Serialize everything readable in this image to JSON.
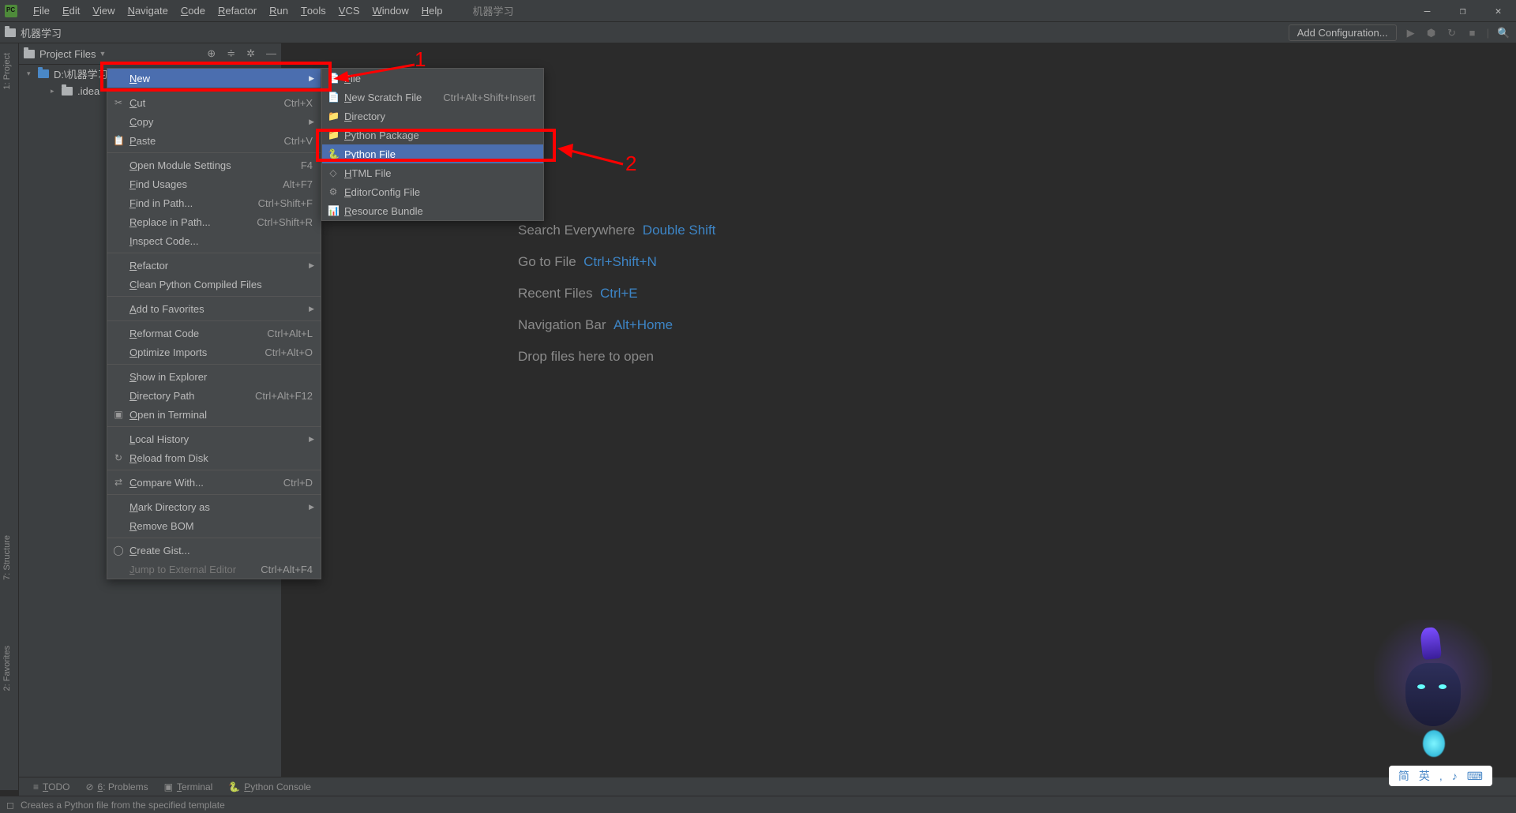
{
  "window_title": "机器学习",
  "menu_bar": [
    "File",
    "Edit",
    "View",
    "Navigate",
    "Code",
    "Refactor",
    "Run",
    "Tools",
    "VCS",
    "Window",
    "Help"
  ],
  "breadcrumb": "机器学习",
  "nav_right": {
    "add_configuration": "Add Configuration..."
  },
  "tool_window": {
    "label": "Project Files"
  },
  "tree": {
    "root": "D:\\机器学习",
    "child": ".idea"
  },
  "context_menu": [
    {
      "label": "New",
      "arrow": true,
      "hl": true
    },
    {
      "sep": true
    },
    {
      "label": "Cut",
      "sc": "Ctrl+X",
      "icon": "✂"
    },
    {
      "label": "Copy",
      "sc": "",
      "arrow": true
    },
    {
      "label": "Paste",
      "sc": "Ctrl+V",
      "icon": "📋"
    },
    {
      "sep": true
    },
    {
      "label": "Open Module Settings",
      "sc": "F4"
    },
    {
      "label": "Find Usages",
      "sc": "Alt+F7"
    },
    {
      "label": "Find in Path...",
      "sc": "Ctrl+Shift+F"
    },
    {
      "label": "Replace in Path...",
      "sc": "Ctrl+Shift+R"
    },
    {
      "label": "Inspect Code..."
    },
    {
      "sep": true
    },
    {
      "label": "Refactor",
      "arrow": true
    },
    {
      "label": "Clean Python Compiled Files"
    },
    {
      "sep": true
    },
    {
      "label": "Add to Favorites",
      "arrow": true
    },
    {
      "sep": true
    },
    {
      "label": "Reformat Code",
      "sc": "Ctrl+Alt+L"
    },
    {
      "label": "Optimize Imports",
      "sc": "Ctrl+Alt+O"
    },
    {
      "sep": true
    },
    {
      "label": "Show in Explorer"
    },
    {
      "label": "Directory Path",
      "sc": "Ctrl+Alt+F12"
    },
    {
      "label": "Open in Terminal",
      "icon": "▣"
    },
    {
      "sep": true
    },
    {
      "label": "Local History",
      "arrow": true
    },
    {
      "label": "Reload from Disk",
      "icon": "↻"
    },
    {
      "sep": true
    },
    {
      "label": "Compare With...",
      "sc": "Ctrl+D",
      "icon": "⇄"
    },
    {
      "sep": true
    },
    {
      "label": "Mark Directory as",
      "arrow": true
    },
    {
      "label": "Remove BOM"
    },
    {
      "sep": true
    },
    {
      "label": "Create Gist...",
      "icon": "◯"
    },
    {
      "label": "Jump to External Editor",
      "sc": "Ctrl+Alt+F4",
      "disabled": true
    }
  ],
  "submenu": [
    {
      "label": "File",
      "icon": "📄"
    },
    {
      "label": "New Scratch File",
      "sc": "Ctrl+Alt+Shift+Insert",
      "icon": "📄"
    },
    {
      "label": "Directory",
      "icon": "📁"
    },
    {
      "label": "Python Package",
      "icon": "📁"
    },
    {
      "label": "Python File",
      "icon": "🐍",
      "hl": true
    },
    {
      "label": "HTML File",
      "icon": "◇"
    },
    {
      "label": "EditorConfig File",
      "icon": "⚙"
    },
    {
      "label": "Resource Bundle",
      "icon": "📊"
    }
  ],
  "editor_hints": [
    {
      "text": "Search Everywhere",
      "shortcut": "Double Shift"
    },
    {
      "text": "Go to File",
      "shortcut": "Ctrl+Shift+N"
    },
    {
      "text": "Recent Files",
      "shortcut": "Ctrl+E"
    },
    {
      "text": "Navigation Bar",
      "shortcut": "Alt+Home"
    },
    {
      "text": "Drop files here to open",
      "shortcut": ""
    }
  ],
  "left_gutter": {
    "project": "1: Project",
    "structure": "7: Structure",
    "favorites": "2: Favorites"
  },
  "bottom_tabs": [
    "TODO",
    "6: Problems",
    "Terminal",
    "Python Console"
  ],
  "status_text": "Creates a Python file from the specified template",
  "ime": [
    "简",
    "英",
    ",",
    "♪",
    "⌨"
  ],
  "annotations": {
    "one": "1",
    "two": "2"
  }
}
